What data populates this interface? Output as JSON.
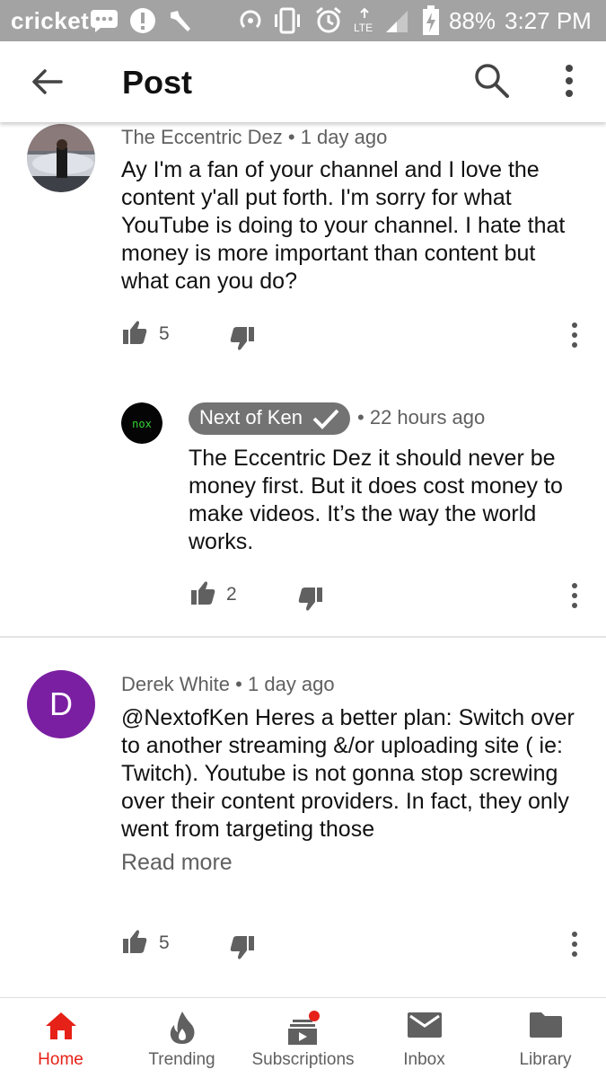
{
  "status_bar": {
    "carrier": "cricket",
    "battery": "88%",
    "time": "3:27 PM",
    "icons": [
      "message-icon",
      "alert-icon",
      "tools-icon",
      "hotspot-icon",
      "vibrate-icon",
      "alarm-icon",
      "lte-signal-icon",
      "battery-icon"
    ]
  },
  "app_bar": {
    "title": "Post",
    "icons": [
      "back-arrow-icon",
      "search-icon",
      "more-vert-icon"
    ]
  },
  "comments": [
    {
      "author": "The Eccentric Dez",
      "separator": "•",
      "time": "1 day ago",
      "text": "Ay I'm a fan of your channel and I love the content y'all put forth. I'm sorry for what YouTube is doing to your channel. I hate that money is more important than content but what can you do?",
      "likes": "5"
    },
    {
      "author": "Next of Ken",
      "is_channel_owner": true,
      "avatar_text": "nox",
      "separator": "•",
      "time": "22 hours ago",
      "text": "The Eccentric Dez it should never be money first. But it does cost money to make videos. It’s the way the world works.",
      "likes": "2"
    },
    {
      "author": "Derek White",
      "avatar_letter": "D",
      "separator": "•",
      "time": "1 day ago",
      "text": "@NextofKen Heres a better plan: Switch over to another streaming &/or uploading site ( ie: Twitch). Youtube is not gonna stop screwing over their content providers. In fact, they only went from targeting those",
      "read_more": "Read more",
      "likes": "5"
    }
  ],
  "bottom_nav": [
    {
      "label": "Home",
      "icon": "home-icon",
      "active": true
    },
    {
      "label": "Trending",
      "icon": "flame-icon"
    },
    {
      "label": "Subscriptions",
      "icon": "subscriptions-icon",
      "badge": true
    },
    {
      "label": "Inbox",
      "icon": "mail-icon"
    },
    {
      "label": "Library",
      "icon": "folder-icon"
    }
  ],
  "colors": {
    "status_bar": "#a3a3a3",
    "accent": "#e62117",
    "owner_chip": "#737373",
    "avatar_purple": "#7b1fa2",
    "secondary_text": "#606060"
  }
}
